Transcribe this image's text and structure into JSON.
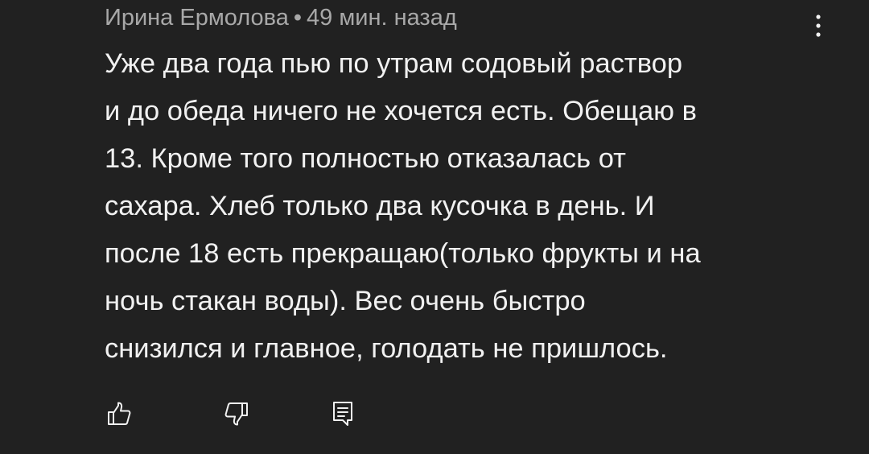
{
  "comment": {
    "author": "Ирина Ермолова",
    "separator": "•",
    "timestamp": "49 мин. назад",
    "text_lines": [
      "Уже два года пью по утрам содовый раствор",
      "и до обеда ничего не хочется есть. Обещаю в",
      "13. Кроме того полностью отказалась от",
      "сахара. Хлеб только два кусочка в день. И",
      "после 18 есть прекращаю(только фрукты и на",
      "ночь стакан воды). Вес очень быстро",
      "снизился и главное, голодать не пришлось."
    ]
  },
  "actions": {
    "like_icon": "thumbs-up-icon",
    "dislike_icon": "thumbs-down-icon",
    "reply_icon": "reply-comment-icon"
  },
  "menu_icon": "more-vertical-icon",
  "colors": {
    "background": "#212121",
    "text": "#f1f1f1",
    "meta": "#a8a8a8",
    "icon": "#f1f1f1"
  }
}
